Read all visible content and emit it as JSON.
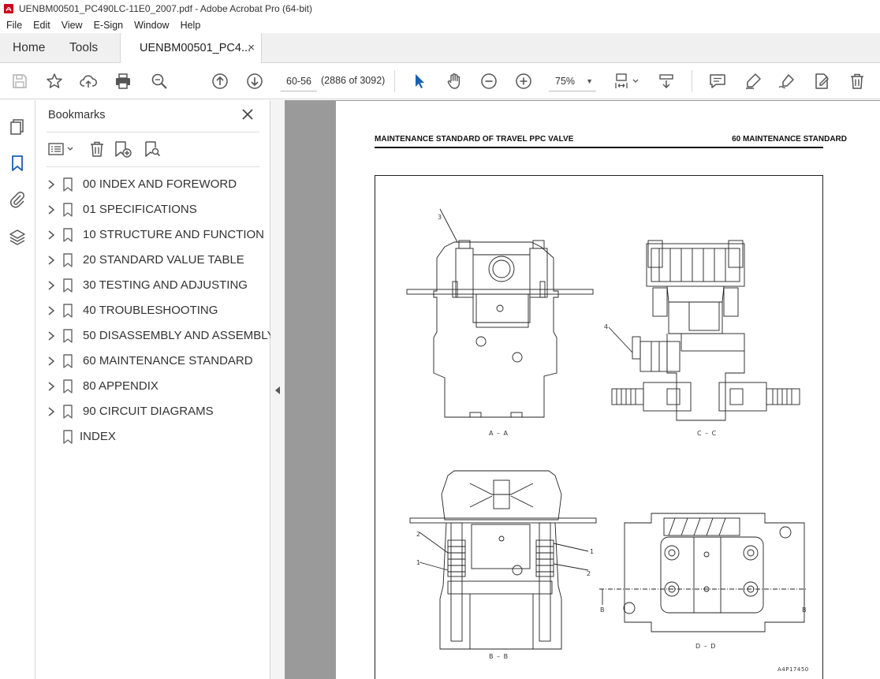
{
  "window": {
    "title": "UENBM00501_PC490LC-11E0_2007.pdf - Adobe Acrobat Pro (64-bit)"
  },
  "menu": [
    "File",
    "Edit",
    "View",
    "E-Sign",
    "Window",
    "Help"
  ],
  "tabs": {
    "home": "Home",
    "tools": "Tools",
    "document": "UENBM00501_PC4...",
    "close_glyph": "×"
  },
  "toolbar": {
    "page_value": "60-56",
    "page_count": "(2886 of 3092)",
    "zoom": "75%"
  },
  "bookmarks": {
    "title": "Bookmarks",
    "items": [
      {
        "label": "00 INDEX AND FOREWORD",
        "expandable": true
      },
      {
        "label": "01 SPECIFICATIONS",
        "expandable": true
      },
      {
        "label": "10 STRUCTURE AND FUNCTION",
        "expandable": true
      },
      {
        "label": "20 STANDARD VALUE TABLE",
        "expandable": true
      },
      {
        "label": "30 TESTING AND ADJUSTING",
        "expandable": true
      },
      {
        "label": "40 TROUBLESHOOTING",
        "expandable": true
      },
      {
        "label": "50 DISASSEMBLY AND ASSEMBLY",
        "expandable": true
      },
      {
        "label": "60 MAINTENANCE STANDARD",
        "expandable": true
      },
      {
        "label": "80 APPENDIX",
        "expandable": true
      },
      {
        "label": "90 CIRCUIT DIAGRAMS",
        "expandable": true
      },
      {
        "label": "INDEX",
        "expandable": false
      }
    ]
  },
  "document": {
    "header_left": "MAINTENANCE STANDARD OF TRAVEL PPC VALVE",
    "header_right": "60 MAINTENANCE STANDARD",
    "captions": {
      "aa": "A – A",
      "cc": "C – C",
      "bb": "B – B",
      "dd": "D – D",
      "fig_id": "A4P17450"
    },
    "callouts": {
      "three": "3",
      "four": "4",
      "one_a": "1",
      "two_a": "2",
      "one_b": "1",
      "two_b": "2",
      "b_left": "B",
      "b_right": "B"
    }
  },
  "colors": {
    "accent_blue": "#1a5fb4",
    "doc_bg": "#9a9a9a",
    "icon_gray": "#5a5a5a"
  }
}
